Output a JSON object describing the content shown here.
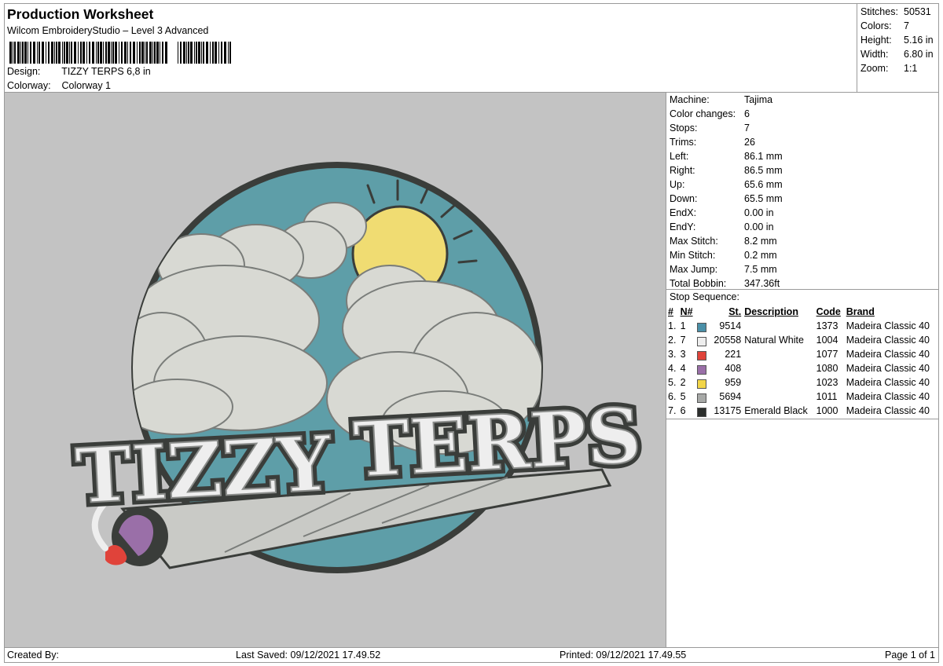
{
  "header": {
    "title": "Production Worksheet",
    "subtitle": "Wilcom EmbroideryStudio – Level 3 Advanced",
    "design_label": "Design:",
    "design_value": "TIZZY TERPS 6,8 in",
    "colorway_label": "Colorway:",
    "colorway_value": "Colorway 1"
  },
  "stats": [
    {
      "label": "Stitches:",
      "value": "50531"
    },
    {
      "label": "Colors:",
      "value": "7"
    },
    {
      "label": "Height:",
      "value": "5.16 in"
    },
    {
      "label": "Width:",
      "value": "6.80 in"
    },
    {
      "label": "Zoom:",
      "value": "1:1"
    }
  ],
  "machine_info": [
    {
      "label": "Machine:",
      "value": "Tajima"
    },
    {
      "label": "Color changes:",
      "value": "6"
    },
    {
      "label": "Stops:",
      "value": "7"
    },
    {
      "label": "Trims:",
      "value": "26"
    },
    {
      "label": "Left:",
      "value": "86.1 mm"
    },
    {
      "label": "Right:",
      "value": "86.5 mm"
    },
    {
      "label": "Up:",
      "value": "65.6 mm"
    },
    {
      "label": "Down:",
      "value": "65.5 mm"
    },
    {
      "label": "EndX:",
      "value": "0.00 in"
    },
    {
      "label": "EndY:",
      "value": "0.00 in"
    },
    {
      "label": "Max Stitch:",
      "value": "8.2 mm"
    },
    {
      "label": "Min Stitch:",
      "value": "0.2 mm"
    },
    {
      "label": "Max Jump:",
      "value": "7.5 mm"
    },
    {
      "label": "Total Bobbin:",
      "value": "347.36ft"
    }
  ],
  "stop_sequence": {
    "title": "Stop Sequence:",
    "columns": [
      "#",
      "N#",
      "St.",
      "Description",
      "Code",
      "Brand"
    ],
    "rows": [
      {
        "idx": "1.",
        "n": "1",
        "color": "#4a90a8",
        "st": "9514",
        "desc": "",
        "code": "1373",
        "brand": "Madeira Classic 40"
      },
      {
        "idx": "2.",
        "n": "7",
        "color": "#eeeeee",
        "st": "20558",
        "desc": "Natural White",
        "code": "1004",
        "brand": "Madeira Classic 40"
      },
      {
        "idx": "3.",
        "n": "3",
        "color": "#e0433a",
        "st": "221",
        "desc": "",
        "code": "1077",
        "brand": "Madeira Classic 40"
      },
      {
        "idx": "4.",
        "n": "4",
        "color": "#9a6fa8",
        "st": "408",
        "desc": "",
        "code": "1080",
        "brand": "Madeira Classic 40"
      },
      {
        "idx": "5.",
        "n": "2",
        "color": "#f2d548",
        "st": "959",
        "desc": "",
        "code": "1023",
        "brand": "Madeira Classic 40"
      },
      {
        "idx": "6.",
        "n": "5",
        "color": "#a7a9a7",
        "st": "5694",
        "desc": "",
        "code": "1011",
        "brand": "Madeira Classic 40"
      },
      {
        "idx": "7.",
        "n": "6",
        "color": "#2b2e2c",
        "st": "13175",
        "desc": "Emerald Black",
        "code": "1000",
        "brand": "Madeira Classic 40"
      }
    ]
  },
  "design_text": {
    "word1": "TIZZY",
    "word2": "TERPS"
  },
  "colors": {
    "sky": "#5e9ea8",
    "cloud": "#d8d9d3",
    "sun": "#f0dc72",
    "outline": "#3a3d3a",
    "canvas": "#c3c3c3"
  },
  "footer": {
    "created": "Created By:",
    "saved": "Last Saved: 09/12/2021 17.49.52",
    "printed": "Printed: 09/12/2021 17.49.55",
    "page": "Page 1 of 1"
  }
}
